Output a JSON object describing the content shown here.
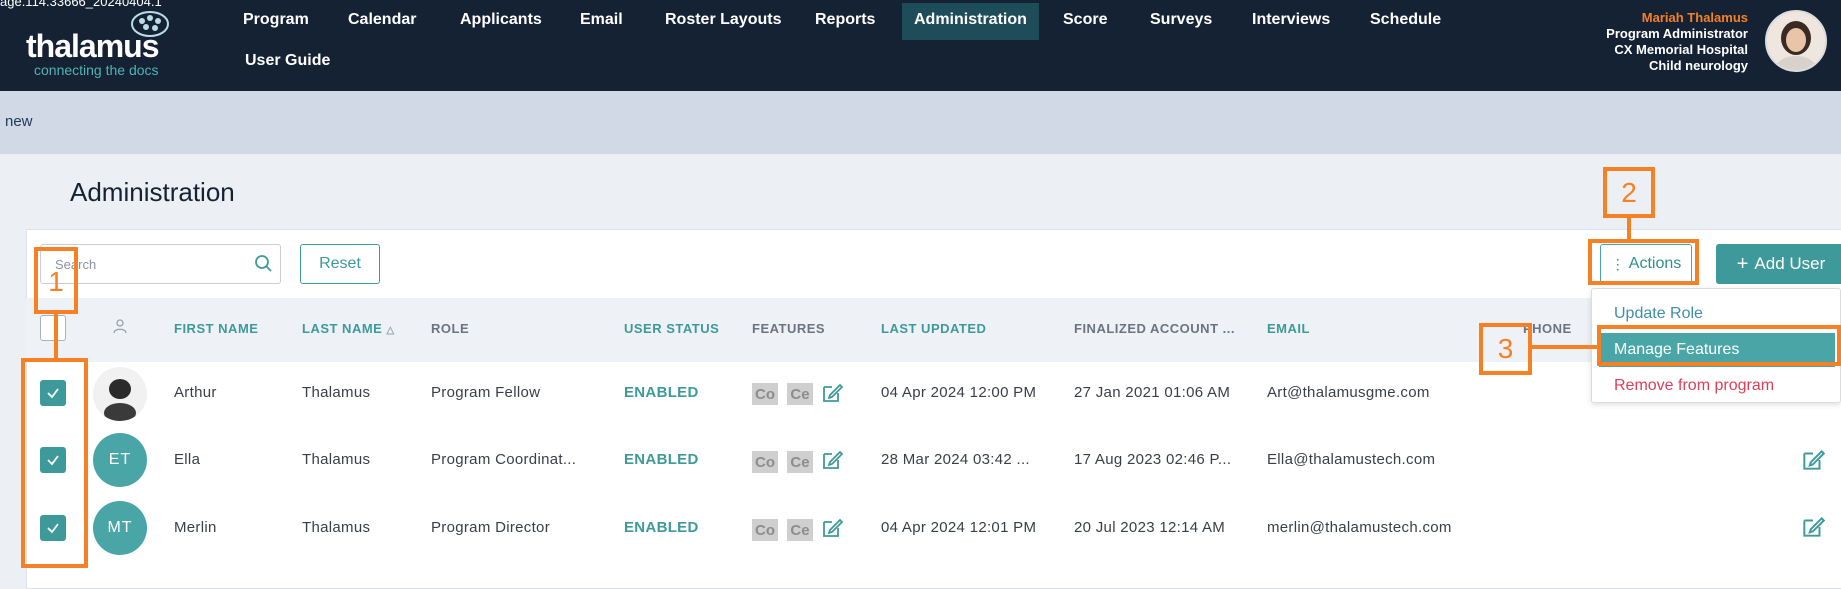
{
  "header": {
    "build_label": "age.114.33666_20240404.1",
    "logo_word": "thalamus",
    "logo_tagline": "connecting the docs",
    "nav": [
      "Program",
      "Calendar",
      "Applicants",
      "Email",
      "Roster Layouts",
      "Reports",
      "Administration",
      "Score",
      "Surveys",
      "Interviews",
      "Schedule",
      "User Guide"
    ],
    "active_nav": "Administration",
    "user": {
      "name": "Mariah Thalamus",
      "role": "Program Administrator",
      "hospital": "CX Memorial Hospital",
      "specialty": "Child neurology"
    }
  },
  "subbar": {
    "label": "new"
  },
  "page": {
    "title": "Administration"
  },
  "toolbar": {
    "search_placeholder": "Search",
    "reset_label": "Reset",
    "actions_label": "Actions",
    "add_user_label": "Add User"
  },
  "table": {
    "columns": [
      "FIRST NAME",
      "LAST NAME",
      "ROLE",
      "USER STATUS",
      "FEATURES",
      "LAST UPDATED",
      "FINALIZED ACCOUNT ...",
      "EMAIL",
      "PHONE"
    ],
    "rows": [
      {
        "initials": "",
        "first": "Arthur",
        "last": "Thalamus",
        "role": "Program Fellow",
        "status": "ENABLED",
        "features": [
          "Co",
          "Ce"
        ],
        "updated": "04 Apr 2024 12:00 PM",
        "finalized": "27 Jan 2021 01:06 AM",
        "email": "Art@thalamusgme.com"
      },
      {
        "initials": "ET",
        "first": "Ella",
        "last": "Thalamus",
        "role": "Program Coordinat...",
        "status": "ENABLED",
        "features": [
          "Co",
          "Ce"
        ],
        "updated": "28 Mar 2024 03:42 ...",
        "finalized": "17 Aug 2023 02:46 P...",
        "email": "Ella@thalamustech.com"
      },
      {
        "initials": "MT",
        "first": "Merlin",
        "last": "Thalamus",
        "role": "Program Director",
        "status": "ENABLED",
        "features": [
          "Co",
          "Ce"
        ],
        "updated": "04 Apr 2024 12:01 PM",
        "finalized": "20 Jul 2023 12:14 AM",
        "email": "merlin@thalamustech.com"
      }
    ]
  },
  "actions_menu": {
    "items": [
      "Update Role",
      "Manage Features",
      "Remove from program"
    ],
    "highlighted": "Manage Features"
  },
  "annotations": [
    "1",
    "2",
    "3"
  ],
  "colors": {
    "navbar": "#152234",
    "accent": "#3e9a9a",
    "annotation": "#f58025",
    "danger": "#d9415a"
  }
}
